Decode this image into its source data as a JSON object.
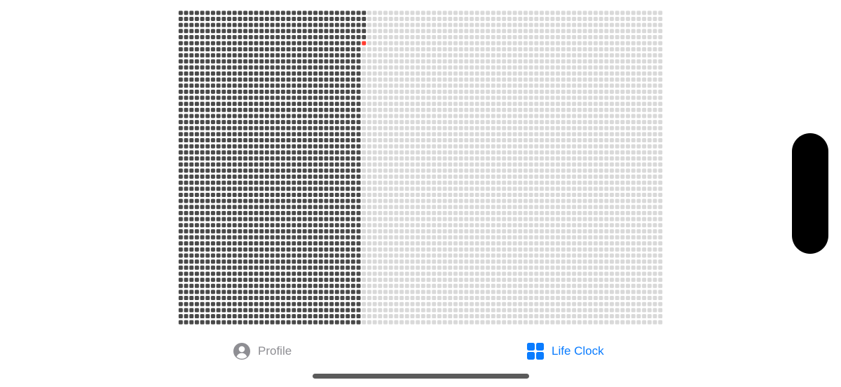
{
  "life_clock": {
    "total_weeks": 4680,
    "lived_weeks": 1773,
    "current_week_index": 1773,
    "columns": 90,
    "rows": 52,
    "colors": {
      "lived": "#4a4a4a",
      "remaining": "#d9d9d9",
      "current": "#ff3b30"
    }
  },
  "tab_bar": {
    "tabs": [
      {
        "label": "Profile",
        "icon": "person-circle-icon",
        "selected": false,
        "color": "#8e8e93"
      },
      {
        "label": "Life Clock",
        "icon": "grid-icon",
        "selected": true,
        "color": "#0a7cff"
      }
    ]
  }
}
